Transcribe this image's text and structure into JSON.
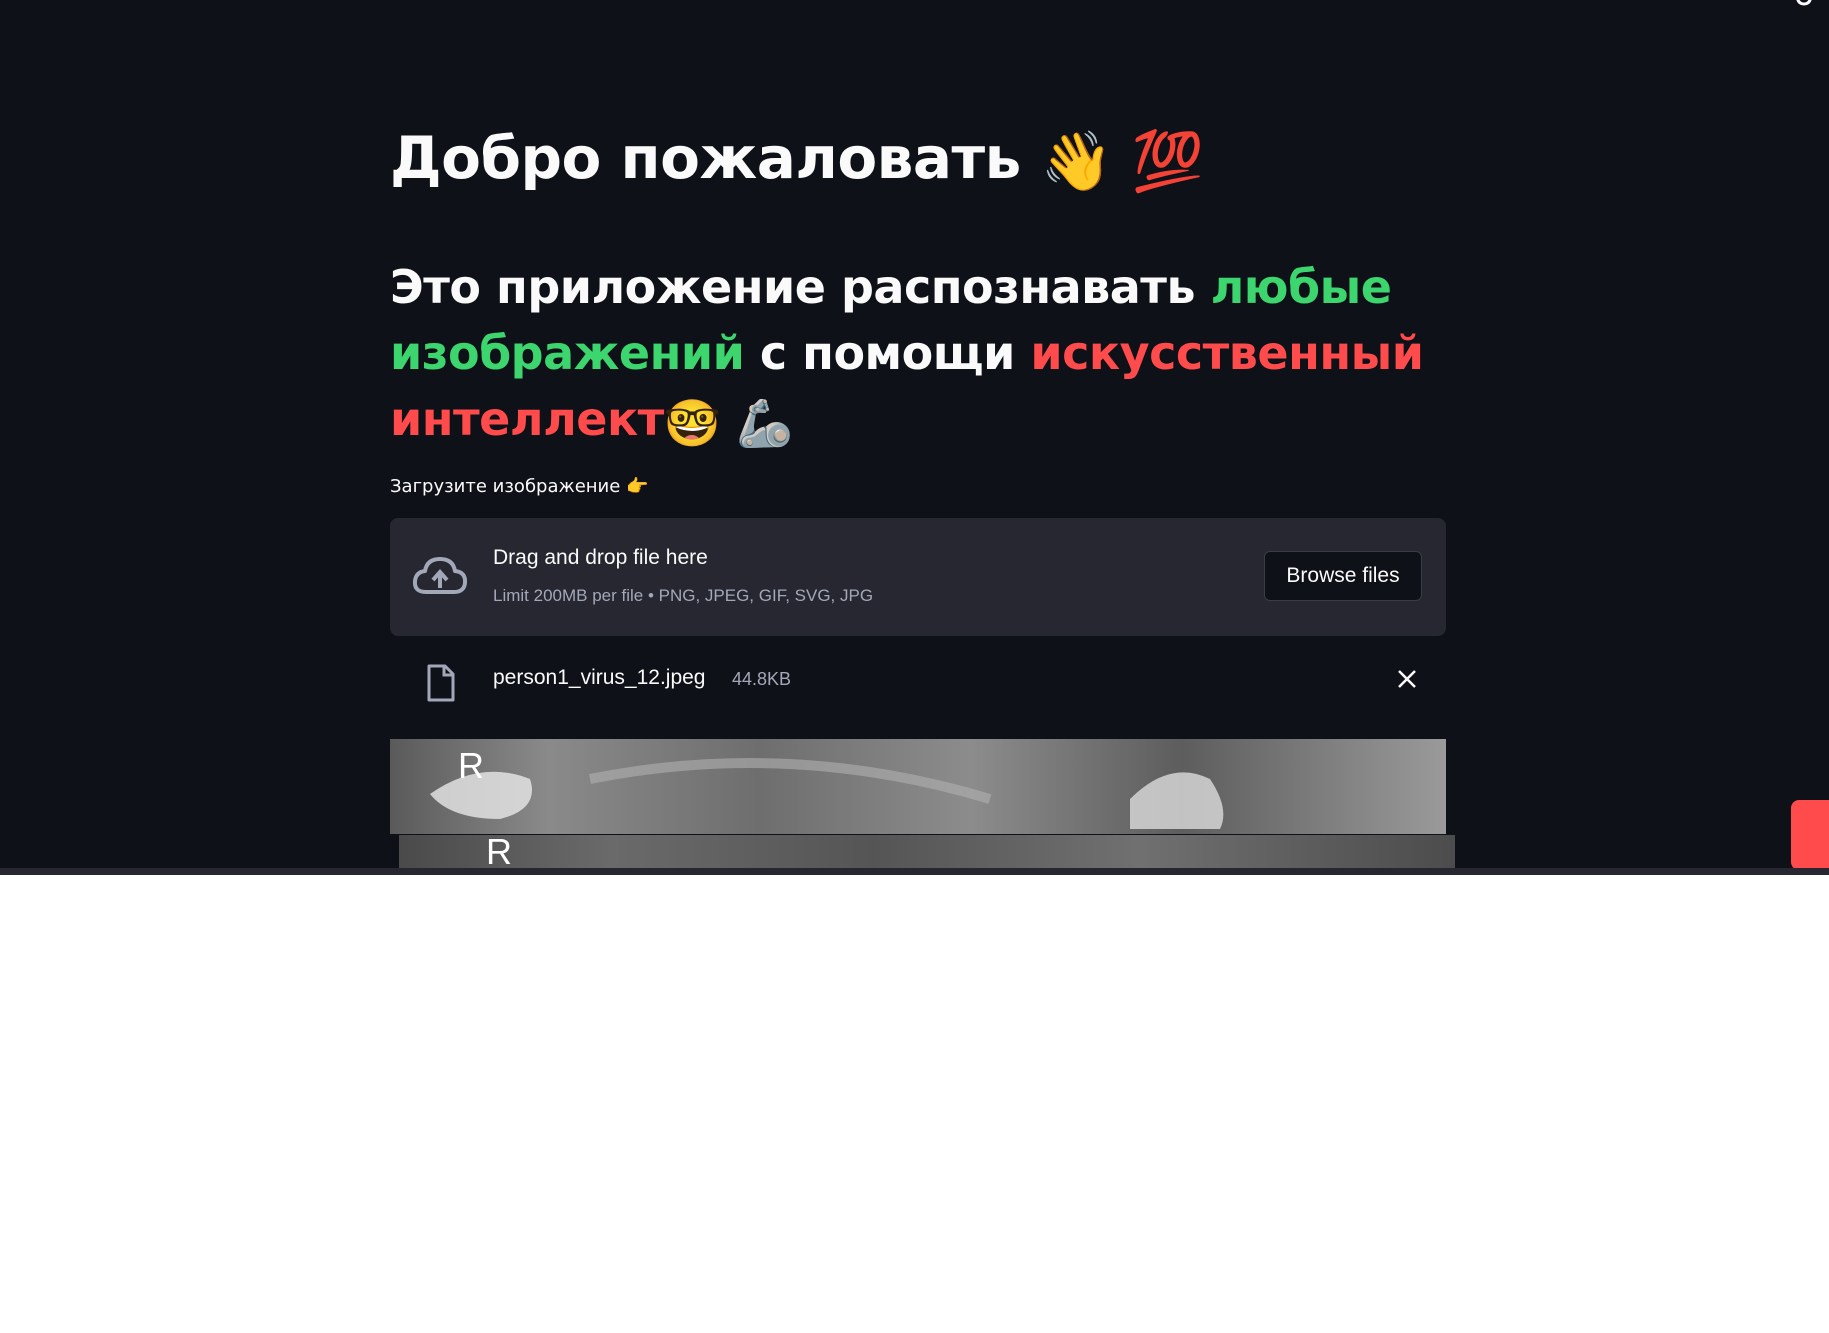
{
  "header": {
    "title_text": "Добро пожаловать",
    "title_emoji_1": "👋",
    "title_emoji_2": "💯"
  },
  "intro": {
    "part1": "Это приложение распознавать ",
    "part2_green": "любые изображений",
    "part3": " с помощи ",
    "part4_red": "искусственный интеллект",
    "emoji_1": "🤓",
    "emoji_2": "🦾"
  },
  "uploader": {
    "label": "Загрузите изображение",
    "label_emoji": "👉",
    "drop_title": "Drag and drop file here",
    "drop_limit": "Limit 200MB per file • PNG, JPEG, GIF, SVG, JPG",
    "browse_label": "Browse files"
  },
  "uploaded_file": {
    "name": "person1_virus_12.jpeg",
    "size": "44.8KB"
  },
  "image_preview": {
    "marker_top": "R",
    "marker_bottom": "R"
  },
  "colors": {
    "background": "#0e1117",
    "green": "#3dd56d",
    "red": "#ff4b4b",
    "dropzone": "#262730"
  }
}
